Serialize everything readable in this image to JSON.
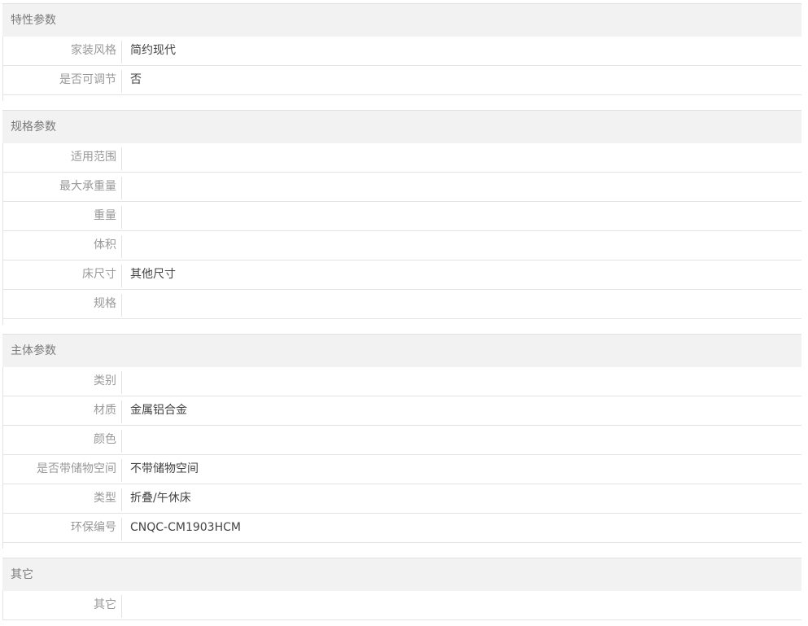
{
  "sections": [
    {
      "title": "特性参数",
      "rows": [
        {
          "label": "家装风格",
          "value": "简约现代"
        },
        {
          "label": "是否可调节",
          "value": "否"
        }
      ]
    },
    {
      "title": "规格参数",
      "rows": [
        {
          "label": "适用范围",
          "value": ""
        },
        {
          "label": "最大承重量",
          "value": ""
        },
        {
          "label": "重量",
          "value": ""
        },
        {
          "label": "体积",
          "value": ""
        },
        {
          "label": "床尺寸",
          "value": "其他尺寸"
        },
        {
          "label": "规格",
          "value": ""
        }
      ]
    },
    {
      "title": "主体参数",
      "rows": [
        {
          "label": "类别",
          "value": ""
        },
        {
          "label": "材质",
          "value": "金属铝合金"
        },
        {
          "label": "颜色",
          "value": ""
        },
        {
          "label": "是否带储物空间",
          "value": "不带储物空间"
        },
        {
          "label": "类型",
          "value": "折叠/午休床"
        },
        {
          "label": "环保编号",
          "value": "CNQC-CM1903HCM"
        }
      ]
    },
    {
      "title": "其它",
      "rows": [
        {
          "label": "其它",
          "value": ""
        }
      ]
    }
  ]
}
